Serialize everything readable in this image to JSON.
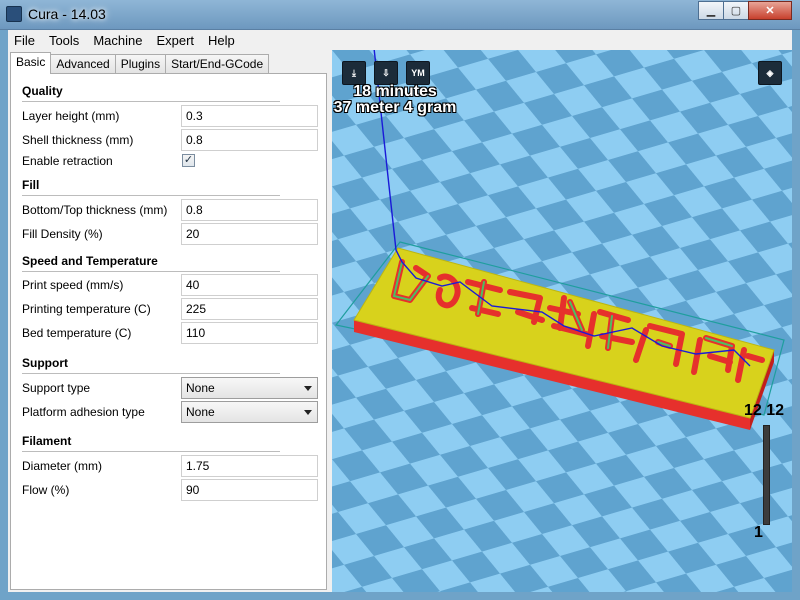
{
  "window": {
    "title": "Cura - 14.03"
  },
  "menu": [
    "File",
    "Tools",
    "Machine",
    "Expert",
    "Help"
  ],
  "tabs": [
    "Basic",
    "Advanced",
    "Plugins",
    "Start/End-GCode"
  ],
  "sections": {
    "quality": {
      "title": "Quality",
      "layer_height": {
        "label": "Layer height (mm)",
        "value": "0.3"
      },
      "shell_thickness": {
        "label": "Shell thickness (mm)",
        "value": "0.8"
      },
      "enable_retraction": {
        "label": "Enable retraction",
        "checked": true,
        "mark": "✓"
      }
    },
    "fill": {
      "title": "Fill",
      "bottom_top_thickness": {
        "label": "Bottom/Top thickness (mm)",
        "value": "0.8"
      },
      "fill_density": {
        "label": "Fill Density (%)",
        "value": "20"
      }
    },
    "speed": {
      "title": "Speed and Temperature",
      "print_speed": {
        "label": "Print speed (mm/s)",
        "value": "40"
      },
      "printing_temperature": {
        "label": "Printing temperature (C)",
        "value": "225"
      },
      "bed_temperature": {
        "label": "Bed temperature (C)",
        "value": "110"
      }
    },
    "support": {
      "title": "Support",
      "support_type": {
        "label": "Support type",
        "value": "None"
      },
      "platform_adhesion": {
        "label": "Platform adhesion type",
        "value": "None"
      }
    },
    "filament": {
      "title": "Filament",
      "diameter": {
        "label": "Diameter (mm)",
        "value": "1.75"
      },
      "flow": {
        "label": "Flow (%)",
        "value": "90"
      }
    }
  },
  "viewport": {
    "toolbar": [
      {
        "icon": "load-model-icon"
      },
      {
        "icon": "save-toolpath-icon"
      },
      {
        "icon": "ym-icon",
        "text": "YM"
      }
    ],
    "view_mode_icon": "view-mode-icon",
    "print_time": "18 minutes",
    "print_material": "37 meter 4 gram",
    "layer_top": "12 12",
    "layer_bottom": "1"
  },
  "colors": {
    "grid_light": "#8ecdf2",
    "grid_dark": "#5fa3cf",
    "model_top": "#d8d21c",
    "model_side": "#e6302c",
    "travel_path": "#1a1ad8",
    "bounding_box": "#1f9e9e"
  }
}
